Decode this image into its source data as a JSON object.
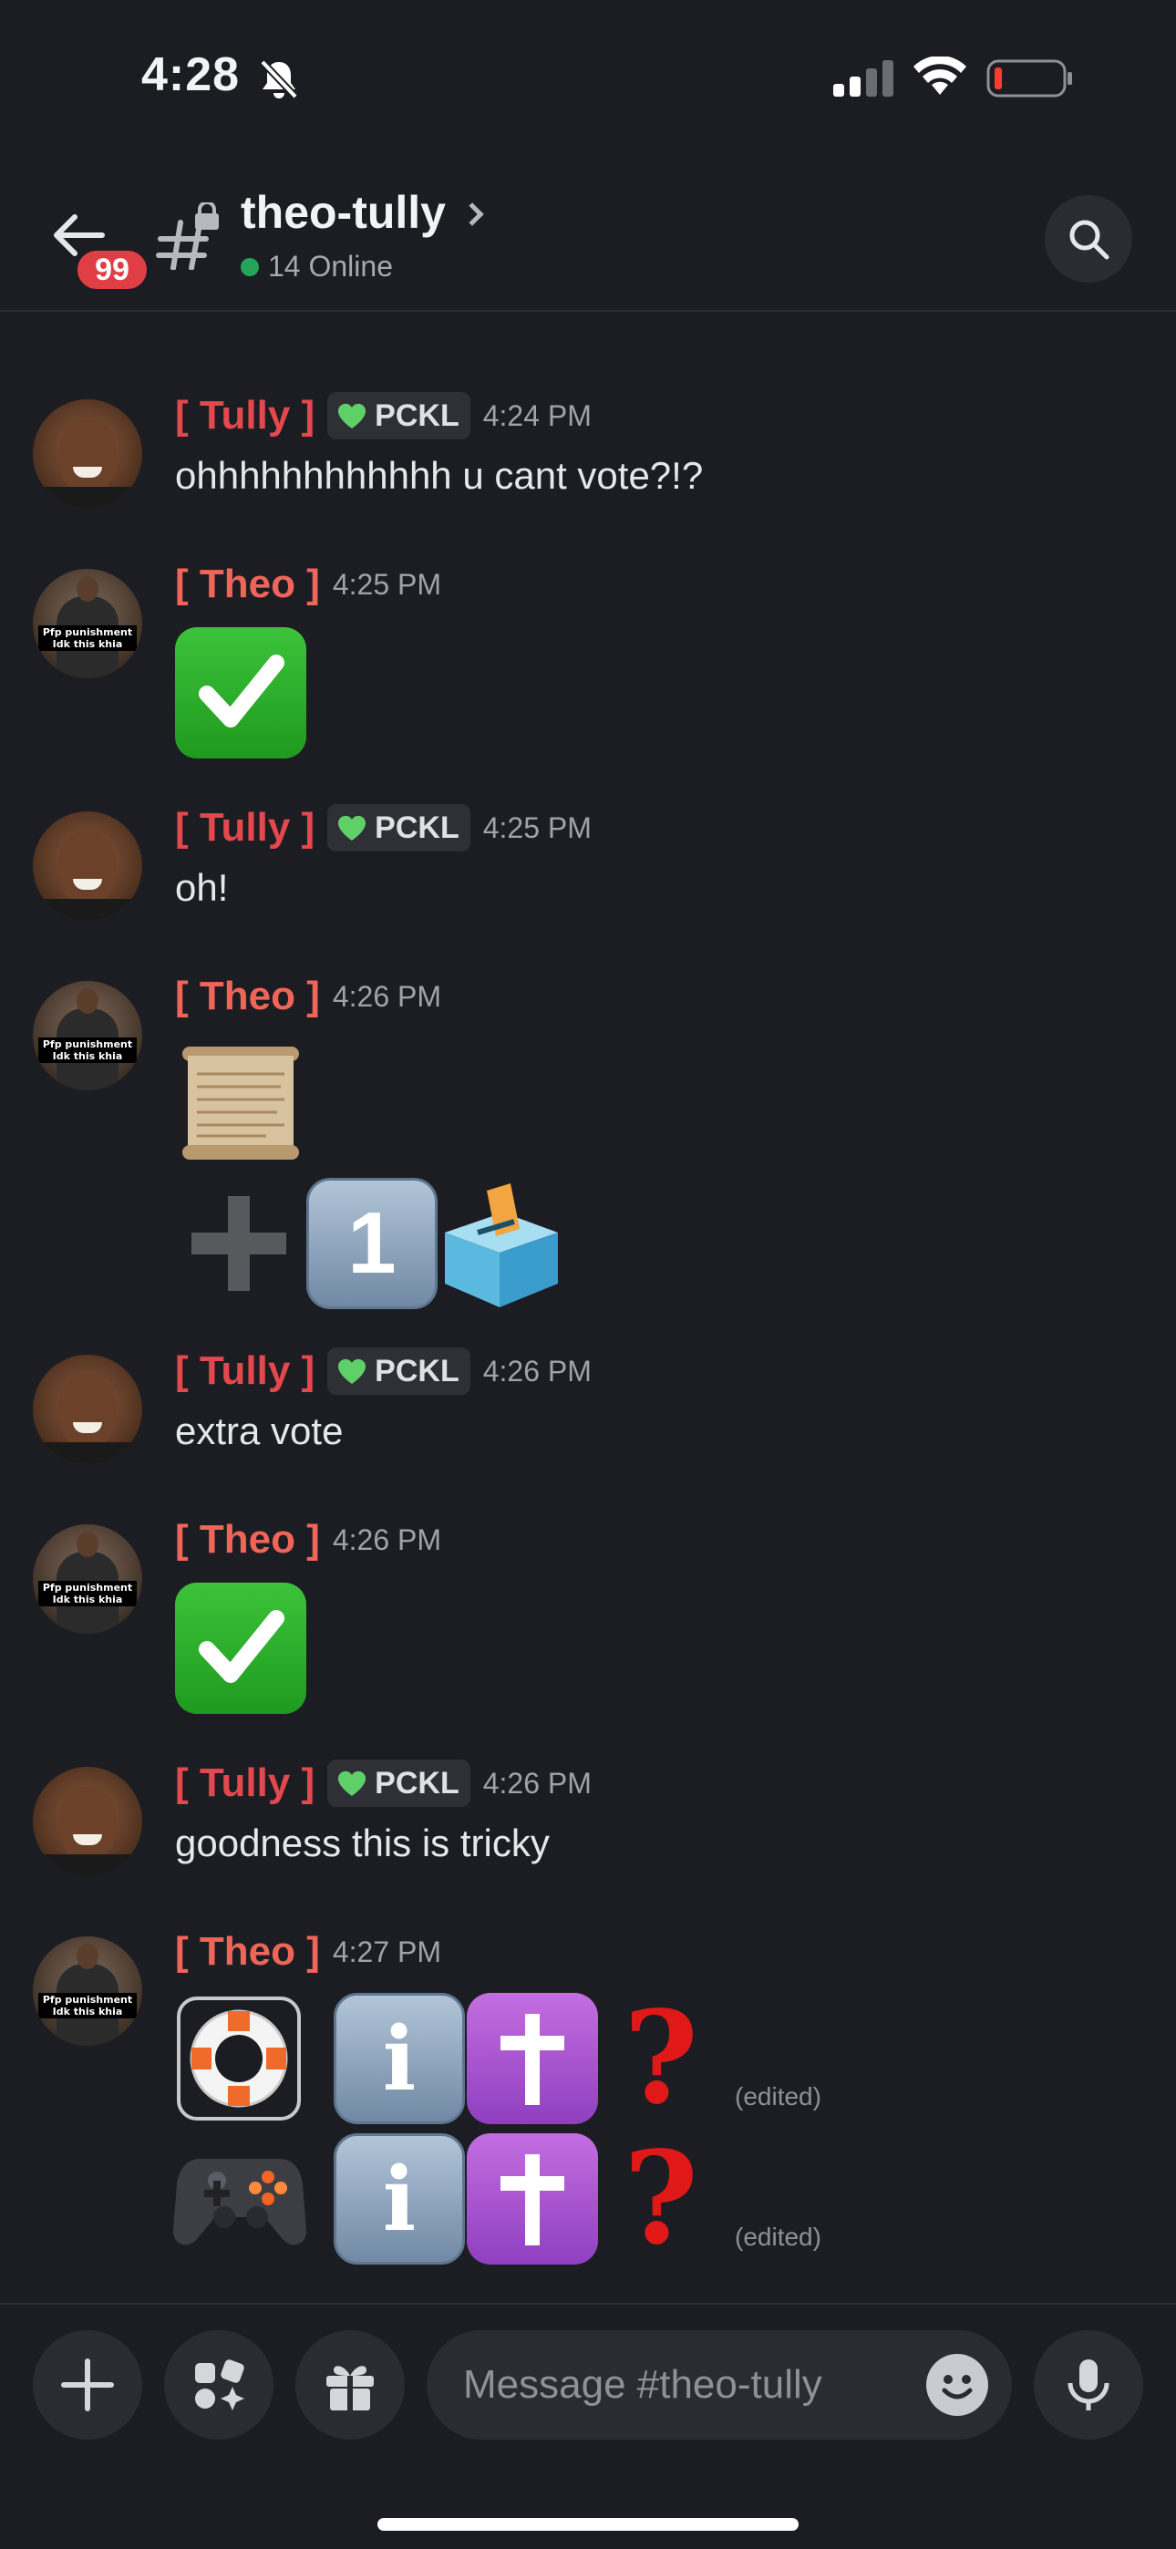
{
  "status_bar": {
    "time": "4:28"
  },
  "header": {
    "unread_badge": "99",
    "channel_name": "theo-tully",
    "online_text": "14 Online"
  },
  "messages": [
    {
      "author": "[ Tully ]",
      "tag": "PCKL",
      "time": "4:24 PM",
      "text": "ohhhhhhhhhhhh u cant vote?!?"
    },
    {
      "author": "[ Theo ]",
      "time": "4:25 PM",
      "emoji": "white-check-mark"
    },
    {
      "author": "[ Tully ]",
      "tag": "PCKL",
      "time": "4:25 PM",
      "text": "oh!"
    },
    {
      "author": "[ Theo ]",
      "time": "4:26 PM",
      "emoji": [
        "scroll",
        "plus",
        "keycap-1",
        "ballot-box"
      ],
      "keycap_label": "1"
    },
    {
      "author": "[ Tully ]",
      "tag": "PCKL",
      "time": "4:26 PM",
      "text": "extra vote"
    },
    {
      "author": "[ Theo ]",
      "time": "4:26 PM",
      "emoji": "white-check-mark"
    },
    {
      "author": "[ Tully ]",
      "tag": "PCKL",
      "time": "4:26 PM",
      "text": "goodness this is tricky"
    },
    {
      "author": "[ Theo ]",
      "time": "4:27 PM",
      "lines": [
        {
          "emoji": [
            "ring-buoy",
            "information",
            "latin-cross",
            "question-mark"
          ],
          "edited": "(edited)"
        },
        {
          "emoji": [
            "video-game",
            "information",
            "latin-cross",
            "question-mark"
          ],
          "edited": "(edited)"
        }
      ],
      "info_label": "i",
      "question_label": "?"
    }
  ],
  "avatar_captions": {
    "theo": "Pfp punishment Idk this khia"
  },
  "composer": {
    "placeholder": "Message #theo-tully"
  },
  "colors": {
    "tully": "#e2484d",
    "theo": "#f0655a",
    "background": "#1c1d22",
    "online": "#23a55a",
    "badge": "#e03e45"
  }
}
